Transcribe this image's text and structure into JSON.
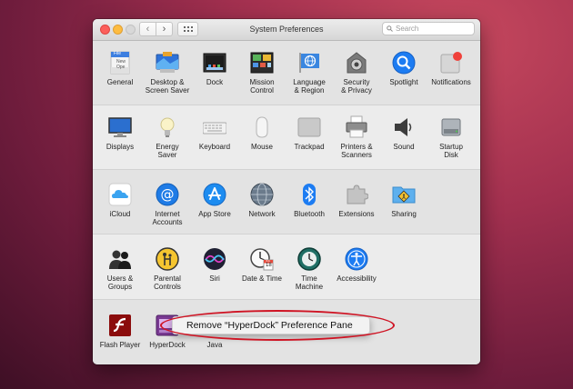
{
  "window": {
    "title": "System Preferences",
    "search_placeholder": "Search",
    "back_glyph": "‹",
    "forward_glyph": "›"
  },
  "sections": [
    {
      "items": [
        {
          "label": "General",
          "icon": "general-icon"
        },
        {
          "label": "Desktop &\nScreen Saver",
          "icon": "desktop-icon"
        },
        {
          "label": "Dock",
          "icon": "dock-icon"
        },
        {
          "label": "Mission\nControl",
          "icon": "mission-control-icon"
        },
        {
          "label": "Language\n& Region",
          "icon": "language-icon"
        },
        {
          "label": "Security\n& Privacy",
          "icon": "security-icon"
        },
        {
          "label": "Spotlight",
          "icon": "spotlight-icon"
        },
        {
          "label": "Notifications",
          "icon": "notifications-icon"
        }
      ]
    },
    {
      "items": [
        {
          "label": "Displays",
          "icon": "displays-icon"
        },
        {
          "label": "Energy\nSaver",
          "icon": "energy-saver-icon"
        },
        {
          "label": "Keyboard",
          "icon": "keyboard-icon"
        },
        {
          "label": "Mouse",
          "icon": "mouse-icon"
        },
        {
          "label": "Trackpad",
          "icon": "trackpad-icon"
        },
        {
          "label": "Printers &\nScanners",
          "icon": "printer-icon"
        },
        {
          "label": "Sound",
          "icon": "sound-icon"
        },
        {
          "label": "Startup\nDisk",
          "icon": "startup-disk-icon"
        }
      ]
    },
    {
      "items": [
        {
          "label": "iCloud",
          "icon": "icloud-icon"
        },
        {
          "label": "Internet\nAccounts",
          "icon": "internet-accounts-icon"
        },
        {
          "label": "App Store",
          "icon": "app-store-icon"
        },
        {
          "label": "Network",
          "icon": "network-icon"
        },
        {
          "label": "Bluetooth",
          "icon": "bluetooth-icon"
        },
        {
          "label": "Extensions",
          "icon": "extensions-icon"
        },
        {
          "label": "Sharing",
          "icon": "sharing-icon"
        }
      ]
    },
    {
      "items": [
        {
          "label": "Users &\nGroups",
          "icon": "users-icon"
        },
        {
          "label": "Parental\nControls",
          "icon": "parental-controls-icon"
        },
        {
          "label": "Siri",
          "icon": "siri-icon"
        },
        {
          "label": "Date & Time",
          "icon": "date-time-icon"
        },
        {
          "label": "Time\nMachine",
          "icon": "time-machine-icon"
        },
        {
          "label": "Accessibility",
          "icon": "accessibility-icon"
        }
      ]
    },
    {
      "items": [
        {
          "label": "Flash Player",
          "icon": "flash-player-icon"
        },
        {
          "label": "HyperDock",
          "icon": "hyperdock-icon"
        },
        {
          "label": "Java",
          "icon": "java-icon"
        }
      ]
    }
  ],
  "icon_text": {
    "general_file": "File",
    "general_new": "New",
    "general_ope": "Ope",
    "date_month": "JUL",
    "date_day": "18"
  },
  "context_menu": {
    "item": "Remove “HyperDock” Preference Pane"
  },
  "colors": {
    "annotation": "#cf1424",
    "accent_blue": "#1d7cf2"
  }
}
